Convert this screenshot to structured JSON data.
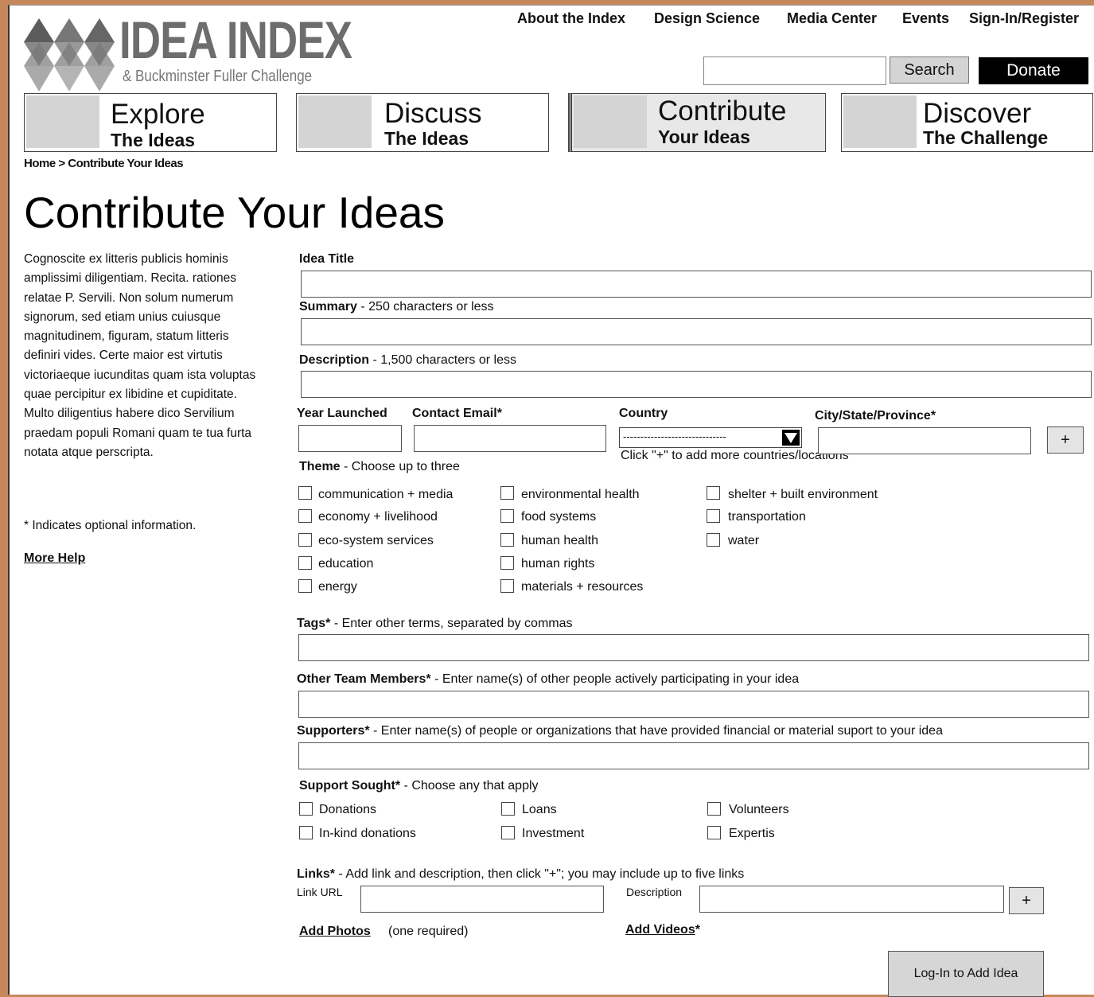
{
  "header": {
    "logo_title": "IDEA INDEX",
    "logo_subtitle": "& Buckminster Fuller Challenge",
    "nav": [
      "About the Index",
      "Design Science",
      "Media Center",
      "Events",
      "Sign-In/Register"
    ],
    "search_button": "Search",
    "donate_button": "Donate"
  },
  "tabs": [
    {
      "line1": "Explore",
      "line2": "The Ideas"
    },
    {
      "line1": "Discuss",
      "line2": "The Ideas"
    },
    {
      "line1": "Contribute",
      "line2": "Your Ideas"
    },
    {
      "line1": "Discover",
      "line2": "The Challenge"
    }
  ],
  "breadcrumb": "Home > Contribute Your Ideas",
  "page_title": "Contribute Your Ideas",
  "sidebar": {
    "intro": "Cognoscite ex litteris publicis hominis amplissimi diligentiam. Recita. rationes relatae P. Servili. Non solum numerum signorum, sed etiam unius cuiusque magnitudinem, figuram, statum litteris definiri vides. Certe maior est virtutis victoriaeque iucunditas quam ista voluptas quae percipitur ex libidine et cupiditate. Multo diligentius habere dico Servilium praedam populi Romani quam te tua furta notata atque perscripta.",
    "optional_note": "* Indicates optional information.",
    "more_help": "More Help"
  },
  "form": {
    "idea_title_label": "Idea Title",
    "summary_label_bold": "Summary",
    "summary_label_rest": " - 250 characters or less",
    "description_label_bold": "Description",
    "description_label_rest": " - 1,500 characters or less",
    "year_label": "Year Launched",
    "email_label": "Contact Email*",
    "country_label": "Country",
    "country_select_value": "------------------------------",
    "city_label": "City/State/Province*",
    "country_hint": "Click \"+\" to add more countries/locations",
    "theme_label_bold": "Theme",
    "theme_label_rest": " - Choose up to three",
    "themes": [
      [
        "communication + media",
        "economy + livelihood",
        "eco-system services",
        "education",
        "energy"
      ],
      [
        "environmental health",
        "food systems",
        "human health",
        "human rights",
        "materials + resources"
      ],
      [
        "shelter + built environment",
        "transportation",
        "water"
      ]
    ],
    "tags_label_bold": "Tags*",
    "tags_label_rest": " - Enter other terms, separated by commas",
    "team_label_bold": "Other Team Members*",
    "team_label_rest": " - Enter name(s) of other people actively participating in your idea",
    "supporters_label_bold": "Supporters*",
    "supporters_label_rest": " - Enter name(s) of people or organizations that have provided financial or material suport to your idea",
    "support_label_bold": "Support Sought*",
    "support_label_rest": " - Choose any that apply",
    "support_options": [
      [
        "Donations",
        "In-kind donations"
      ],
      [
        "Loans",
        "Investment"
      ],
      [
        "Volunteers",
        "Expertis"
      ]
    ],
    "links_label_bold": "Links*",
    "links_label_rest": " - Add link and description, then click \"+\"; you may include up to five links",
    "link_url_label": "Link URL",
    "link_desc_label": "Description",
    "plus": "+",
    "add_photos": "Add Photos",
    "add_photos_note": "(one required)",
    "add_videos": "Add Videos",
    "add_videos_star": "*",
    "login_button": "Log-In to Add Idea"
  }
}
